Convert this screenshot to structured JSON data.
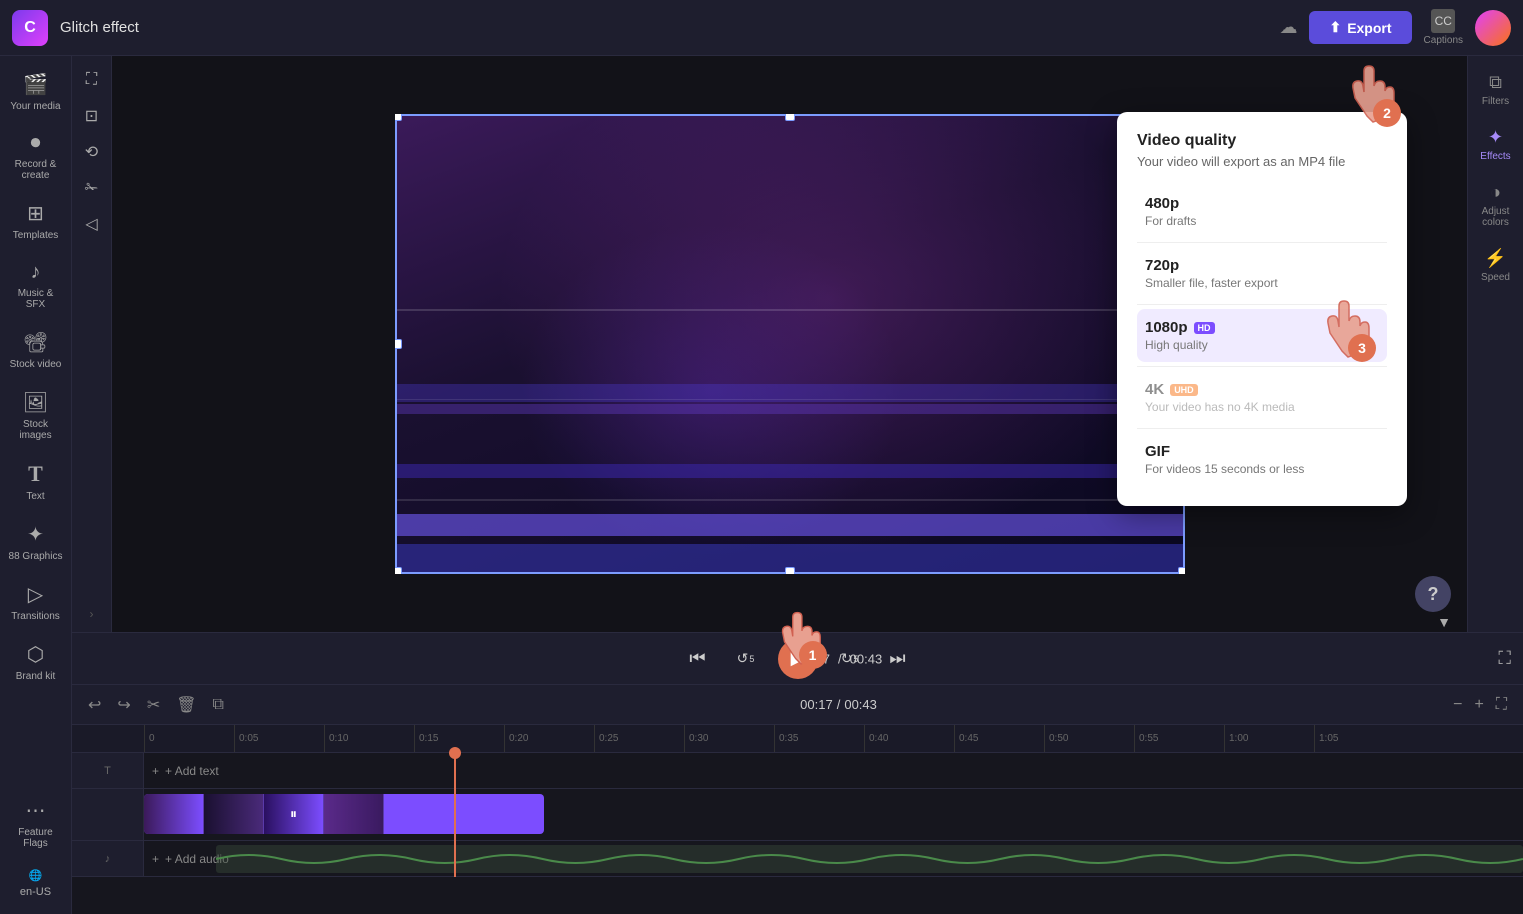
{
  "app": {
    "title": "Glitch effect",
    "logo_char": "C"
  },
  "topbar": {
    "export_label": "Export",
    "captions_label": "Captions",
    "cloud_icon": "☁"
  },
  "left_sidebar": {
    "items": [
      {
        "id": "your-media",
        "icon": "🎬",
        "label": "Your media"
      },
      {
        "id": "record-create",
        "icon": "⏺",
        "label": "Record &\ncreate"
      },
      {
        "id": "templates",
        "icon": "⊞",
        "label": "Templates"
      },
      {
        "id": "music-sfx",
        "icon": "♪",
        "label": "Music & SFX"
      },
      {
        "id": "stock-video",
        "icon": "📽",
        "label": "Stock video"
      },
      {
        "id": "stock-images",
        "icon": "🖼",
        "label": "Stock images"
      },
      {
        "id": "text",
        "icon": "T",
        "label": "Text"
      },
      {
        "id": "graphics",
        "icon": "✦",
        "label": "88 Graphics"
      },
      {
        "id": "transitions",
        "icon": "▷",
        "label": "Transitions"
      },
      {
        "id": "brand-kit",
        "icon": "⬡",
        "label": "Brand kit"
      },
      {
        "id": "feature-flags",
        "icon": "⋯",
        "label": "Feature Flags"
      }
    ]
  },
  "right_sidebar": {
    "items": [
      {
        "id": "filters",
        "icon": "⧉",
        "label": "Filters"
      },
      {
        "id": "effects",
        "icon": "✦",
        "label": "Effects"
      },
      {
        "id": "adjust-colors",
        "icon": "◑",
        "label": "Adjust colors"
      },
      {
        "id": "speed",
        "icon": "⚡",
        "label": "Speed"
      }
    ]
  },
  "vert_toolbar": {
    "tools": [
      {
        "id": "select",
        "icon": "⛶"
      },
      {
        "id": "crop",
        "icon": "⊡"
      },
      {
        "id": "transform",
        "icon": "⟳"
      },
      {
        "id": "split",
        "icon": "⌲"
      },
      {
        "id": "trim",
        "icon": "◁"
      }
    ]
  },
  "playback": {
    "skip_back": "⏮",
    "back_5s": "↺",
    "play": "▶",
    "forward_5s": "↻",
    "skip_forward": "⏭",
    "time_current": "00:17",
    "time_total": "00:43",
    "fullscreen": "⛶"
  },
  "timeline": {
    "undo": "↩",
    "redo": "↪",
    "cut": "✂",
    "delete": "🗑",
    "duplicate": "⧉",
    "time_current": "00:17",
    "time_separator": "/",
    "time_total": "00:43",
    "zoom_out": "−",
    "zoom_in": "+",
    "expand": "⛶",
    "ruler_marks": [
      "0",
      "0:05",
      "0:10",
      "0:15",
      "0:20",
      "0:25",
      "0:30",
      "0:35",
      "0:40",
      "0:45",
      "0:50",
      "0:55",
      "1:00",
      "1:05"
    ],
    "add_text_label": "+ Add text",
    "add_audio_label": "+ Add audio"
  },
  "quality_popup": {
    "title": "Video quality",
    "subtitle": "Your video will export as an MP4 file",
    "options": [
      {
        "id": "480p",
        "name": "480p",
        "desc": "For drafts",
        "badge": null,
        "disabled": false,
        "selected": false
      },
      {
        "id": "720p",
        "name": "720p",
        "desc": "Smaller file, faster export",
        "badge": null,
        "disabled": false,
        "selected": false
      },
      {
        "id": "1080p",
        "name": "1080p",
        "desc": "High quality",
        "badge": "HD",
        "badge_type": "hd",
        "disabled": false,
        "selected": false
      },
      {
        "id": "4k",
        "name": "4K",
        "desc": "Your video has no 4K media",
        "badge": "UHD",
        "badge_type": "uhd",
        "disabled": true,
        "selected": false
      },
      {
        "id": "gif",
        "name": "GIF",
        "desc": "For videos 15 seconds or less",
        "badge": null,
        "disabled": false,
        "selected": false
      }
    ]
  },
  "steps": {
    "step1": "1",
    "step2": "2",
    "step3": "3"
  }
}
